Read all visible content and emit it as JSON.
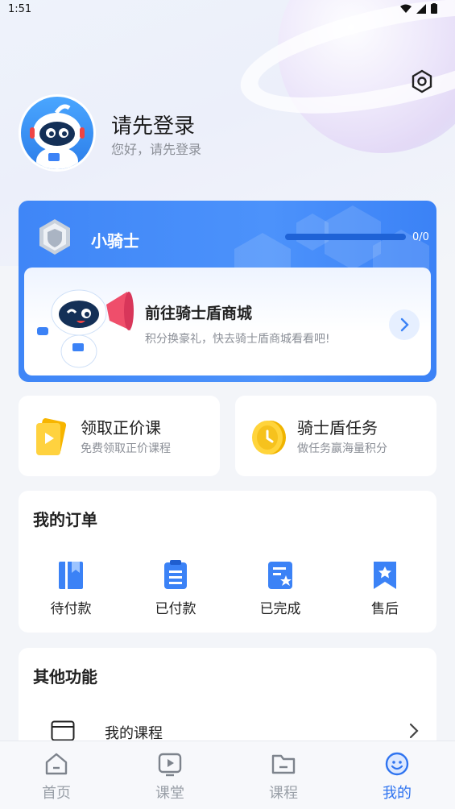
{
  "status_bar": {
    "time": "1:51"
  },
  "profile": {
    "title": "请先登录",
    "subtitle": "您好，请先登录"
  },
  "knight": {
    "level_name": "小骑士",
    "progress_text": "0/0",
    "progress_fraction": 0,
    "mall_title": "前往骑士盾商城",
    "mall_desc": "积分换豪礼，快去骑士盾商城看看吧!"
  },
  "cards": [
    {
      "title": "领取正价课",
      "desc": "免费领取正价课程",
      "icon": "book-coupon-icon"
    },
    {
      "title": "骑士盾任务",
      "desc": "做任务赢海量积分",
      "icon": "coin-icon"
    }
  ],
  "orders": {
    "title": "我的订单",
    "items": [
      {
        "label": "待付款",
        "icon": "wallet-icon"
      },
      {
        "label": "已付款",
        "icon": "paid-list-icon"
      },
      {
        "label": "已完成",
        "icon": "completed-star-icon"
      },
      {
        "label": "售后",
        "icon": "bookmark-star-icon"
      }
    ]
  },
  "other": {
    "title": "其他功能",
    "items": [
      {
        "label": "我的课程",
        "icon": "browser-window-icon"
      }
    ]
  },
  "tabbar": {
    "items": [
      {
        "label": "首页",
        "icon": "home-icon"
      },
      {
        "label": "课堂",
        "icon": "play-icon"
      },
      {
        "label": "课程",
        "icon": "folder-icon"
      },
      {
        "label": "我的",
        "icon": "smile-icon"
      }
    ],
    "active": "我的"
  },
  "colors": {
    "accent": "#2f74f0",
    "knight_bg": "#4289f8",
    "icon_blue": "#3b82f6"
  }
}
